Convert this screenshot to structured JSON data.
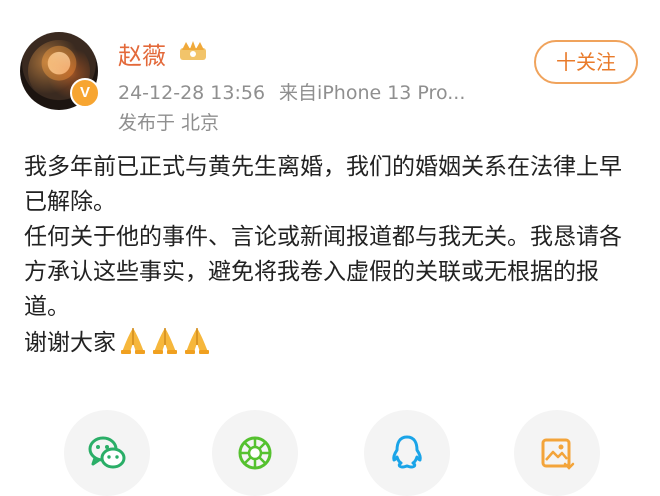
{
  "profile": {
    "username": "赵薇",
    "verified_badge": "V",
    "timestamp": "24-12-28 13:56",
    "source": "来自iPhone 13 Pro...",
    "location": "发布于 北京",
    "follow_label": "十关注"
  },
  "post": {
    "paragraphs": [
      "我多年前已正式与黄先生离婚，我们的婚姻关系在法律上早已解除。",
      "任何关于他的事件、言论或新闻报道都与我无关。我恳请各方承认这些事实，避免将我卷入虚假的关联或无根据的报道。"
    ],
    "closing": "谢谢大家"
  },
  "share": {
    "items": [
      {
        "icon": "wechat-icon",
        "color": "#2aae67"
      },
      {
        "icon": "moments-icon",
        "color": "#55c12f"
      },
      {
        "icon": "qq-icon",
        "color": "#1aa4e8"
      },
      {
        "icon": "save-image-icon",
        "color": "#f3a43a"
      }
    ]
  },
  "colors": {
    "username": "#e3693a",
    "follow": "#e97b2b",
    "meta": "#8f8f8f"
  }
}
